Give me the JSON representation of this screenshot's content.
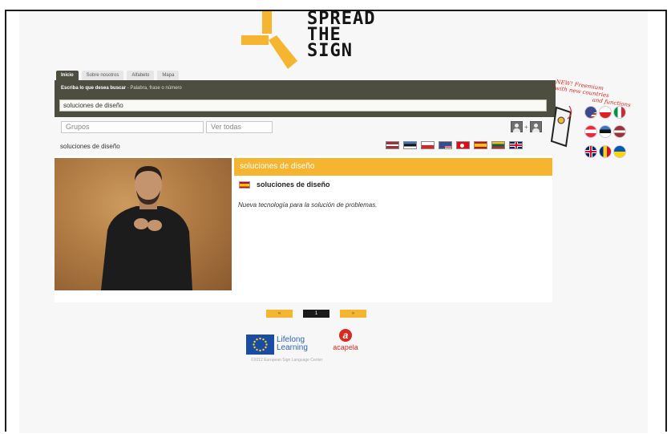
{
  "logo": {
    "lines": [
      "SPREAD",
      "THE",
      "SIGN"
    ]
  },
  "nav": {
    "tabs": [
      {
        "label": "Inicio",
        "active": true
      },
      {
        "label": "Sobre nosotros",
        "active": false
      },
      {
        "label": "Alfabeto",
        "active": false
      },
      {
        "label": "Mapa",
        "active": false
      }
    ]
  },
  "search": {
    "hint_bold": "Escriba lo que desea buscar",
    "hint_rest": " - Palabra, frase o número",
    "value": "soluciones de diseño"
  },
  "filters": {
    "groups_placeholder": "Grupos",
    "all_label": "Ver todas"
  },
  "user_icons": {
    "plus": "+"
  },
  "word_label": "soluciones de diseño",
  "language_flags": [
    "latvia-flag",
    "estonia-flag",
    "poland-flag",
    "usa-flag",
    "turkey-flag",
    "spain-flag",
    "lithuania-flag",
    "uk-flag"
  ],
  "result": {
    "header": "soluciones de diseño",
    "entry_title": "soluciones de diseño",
    "definition": "Nueva tecnología para la solución de problemas."
  },
  "pagination": {
    "prev": "«",
    "current": "1",
    "next": "»"
  },
  "footer": {
    "eu_text_1": "Lifelong",
    "eu_text_2": "Learning",
    "acapela_mark": "a",
    "acapela_text": "acapela",
    "copyright": "©2012 European Sign Language Center"
  },
  "promo": {
    "line1": "NEW! Freemium",
    "line2": "with new countries",
    "line3": "and functions"
  },
  "colors": {
    "accent": "#f5b530",
    "dark_bar": "#4d4d40",
    "promo_red": "#d12d24"
  }
}
